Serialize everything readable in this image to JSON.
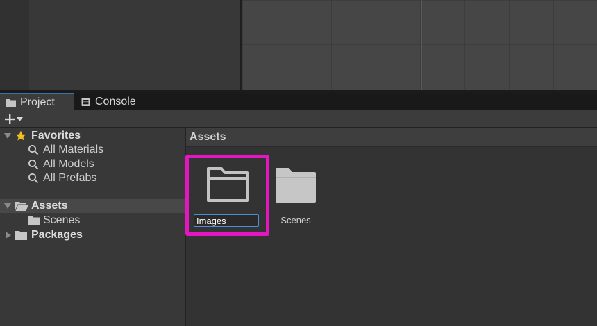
{
  "tabs": {
    "project": "Project",
    "console": "Console"
  },
  "toolbar": {
    "add_icon": "plus-icon",
    "dropdown_icon": "caret-down-icon"
  },
  "tree": {
    "favorites": {
      "label": "Favorites",
      "items": [
        "All Materials",
        "All Models",
        "All Prefabs"
      ]
    },
    "assets": {
      "label": "Assets",
      "children": [
        "Scenes"
      ]
    },
    "packages": {
      "label": "Packages"
    }
  },
  "assets_panel": {
    "title": "Assets",
    "items": [
      {
        "name": "Images",
        "editing": true
      },
      {
        "name": "Scenes",
        "editing": false
      }
    ]
  },
  "colors": {
    "highlight": "#e316c2",
    "tab_accent": "#3a72b0",
    "favorite_star": "#f0c020",
    "input_border": "#4d8fd6"
  }
}
